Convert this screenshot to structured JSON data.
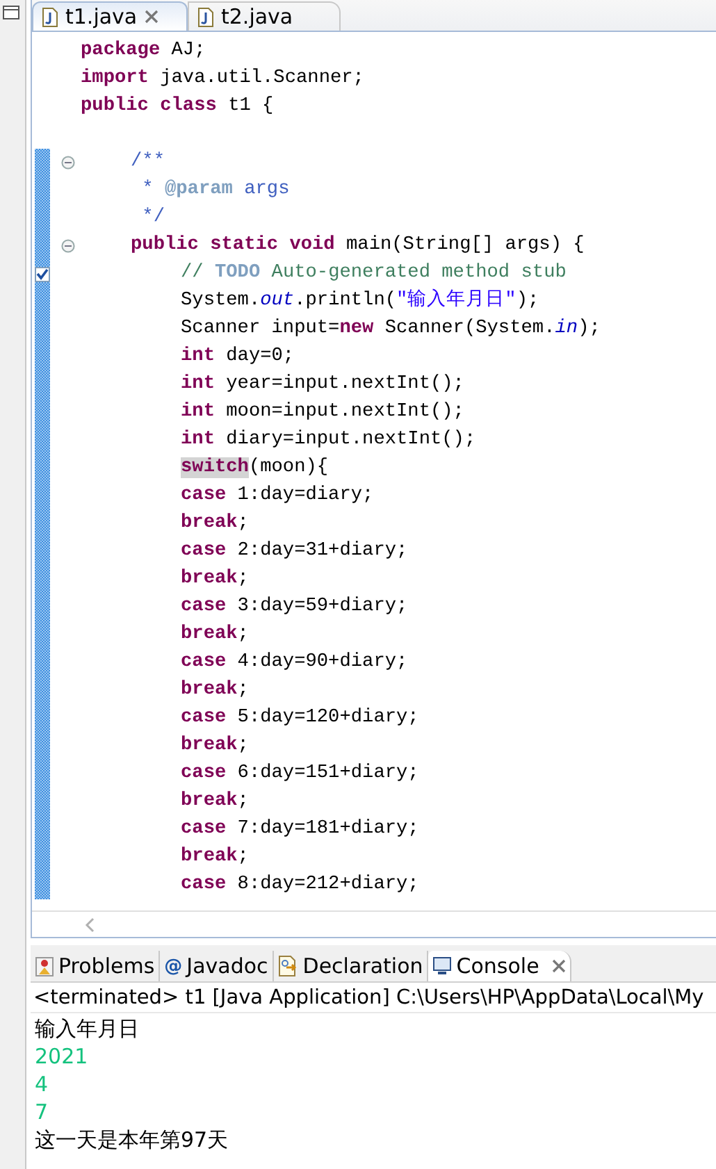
{
  "editor_tabs": [
    {
      "label": "t1.java",
      "selected": true
    },
    {
      "label": "t2.java",
      "selected": false
    }
  ],
  "code": [
    {
      "kind": "code",
      "in_scope": false,
      "tokens": [
        {
          "kind": "kw",
          "text": "package"
        },
        {
          "kind": "plain",
          "text": " AJ;"
        }
      ]
    },
    {
      "kind": "code",
      "in_scope": false,
      "tokens": [
        {
          "kind": "kw",
          "text": "import"
        },
        {
          "kind": "plain",
          "text": " java.util.Scanner;"
        }
      ]
    },
    {
      "kind": "code",
      "in_scope": false,
      "tokens": [
        {
          "kind": "kw",
          "text": "public class"
        },
        {
          "kind": "plain",
          "text": " t1 {"
        }
      ],
      "children": [
        {
          "kind": "blank",
          "in_scope": false
        },
        {
          "kind": "code",
          "in_scope": true,
          "foldable": true,
          "tokens": [
            {
              "kind": "doc",
              "text": "/**"
            }
          ]
        },
        {
          "kind": "code",
          "in_scope": true,
          "tokens": [
            {
              "kind": "doc",
              "text": " * "
            },
            {
              "kind": "doctag",
              "text": "@param"
            },
            {
              "kind": "doc",
              "text": " args"
            }
          ]
        },
        {
          "kind": "code",
          "in_scope": true,
          "tokens": [
            {
              "kind": "doc",
              "text": " */"
            }
          ]
        },
        {
          "kind": "code",
          "in_scope": true,
          "foldable": true,
          "tokens": [
            {
              "kind": "kw",
              "text": "public static void"
            },
            {
              "kind": "plain",
              "text": " main(String[] args) {"
            }
          ],
          "children": [
            {
              "kind": "code",
              "in_scope": true,
              "task": true,
              "tokens": [
                {
                  "kind": "comment",
                  "text": "// "
                },
                {
                  "kind": "todo",
                  "text": "TODO"
                },
                {
                  "kind": "comment",
                  "text": " Auto-generated method stub"
                }
              ]
            },
            {
              "kind": "code",
              "in_scope": true,
              "tokens": [
                {
                  "kind": "plain",
                  "text": "System."
                },
                {
                  "kind": "field",
                  "text": "out"
                },
                {
                  "kind": "plain",
                  "text": ".println("
                },
                {
                  "kind": "string",
                  "text": "\"输入年月日\""
                },
                {
                  "kind": "plain",
                  "text": ");"
                }
              ]
            },
            {
              "kind": "code",
              "in_scope": true,
              "tokens": [
                {
                  "kind": "plain",
                  "text": "Scanner input="
                },
                {
                  "kind": "kw",
                  "text": "new"
                },
                {
                  "kind": "plain",
                  "text": " Scanner(System."
                },
                {
                  "kind": "field",
                  "text": "in"
                },
                {
                  "kind": "plain",
                  "text": ");"
                }
              ]
            },
            {
              "kind": "code",
              "in_scope": true,
              "tokens": [
                {
                  "kind": "kw",
                  "text": "int"
                },
                {
                  "kind": "plain",
                  "text": " day=0;"
                }
              ]
            },
            {
              "kind": "code",
              "in_scope": true,
              "tokens": [
                {
                  "kind": "kw",
                  "text": "int"
                },
                {
                  "kind": "plain",
                  "text": " year=input.nextInt();"
                }
              ]
            },
            {
              "kind": "code",
              "in_scope": true,
              "tokens": [
                {
                  "kind": "kw",
                  "text": "int"
                },
                {
                  "kind": "plain",
                  "text": " moon=input.nextInt();"
                }
              ]
            },
            {
              "kind": "code",
              "in_scope": true,
              "tokens": [
                {
                  "kind": "kw",
                  "text": "int"
                },
                {
                  "kind": "plain",
                  "text": " diary=input.nextInt();"
                }
              ]
            },
            {
              "kind": "code",
              "in_scope": true,
              "tokens": [
                {
                  "kind": "match",
                  "text": "switch"
                },
                {
                  "kind": "plain",
                  "text": "(moon){"
                }
              ]
            },
            {
              "kind": "code",
              "in_scope": true,
              "tokens": [
                {
                  "kind": "kw",
                  "text": "case"
                },
                {
                  "kind": "plain",
                  "text": " 1:day=diary;"
                }
              ]
            },
            {
              "kind": "code",
              "in_scope": true,
              "tokens": [
                {
                  "kind": "kw",
                  "text": "break"
                },
                {
                  "kind": "plain",
                  "text": ";"
                }
              ]
            },
            {
              "kind": "code",
              "in_scope": true,
              "tokens": [
                {
                  "kind": "kw",
                  "text": "case"
                },
                {
                  "kind": "plain",
                  "text": " 2:day=31+diary;"
                }
              ]
            },
            {
              "kind": "code",
              "in_scope": true,
              "tokens": [
                {
                  "kind": "kw",
                  "text": "break"
                },
                {
                  "kind": "plain",
                  "text": ";"
                }
              ]
            },
            {
              "kind": "code",
              "in_scope": true,
              "tokens": [
                {
                  "kind": "kw",
                  "text": "case"
                },
                {
                  "kind": "plain",
                  "text": " 3:day=59+diary;"
                }
              ]
            },
            {
              "kind": "code",
              "in_scope": true,
              "tokens": [
                {
                  "kind": "kw",
                  "text": "break"
                },
                {
                  "kind": "plain",
                  "text": ";"
                }
              ]
            },
            {
              "kind": "code",
              "in_scope": true,
              "tokens": [
                {
                  "kind": "kw",
                  "text": "case"
                },
                {
                  "kind": "plain",
                  "text": " 4:day=90+diary;"
                }
              ]
            },
            {
              "kind": "code",
              "in_scope": true,
              "tokens": [
                {
                  "kind": "kw",
                  "text": "break"
                },
                {
                  "kind": "plain",
                  "text": ";"
                }
              ]
            },
            {
              "kind": "code",
              "in_scope": true,
              "tokens": [
                {
                  "kind": "kw",
                  "text": "case"
                },
                {
                  "kind": "plain",
                  "text": " 5:day=120+diary;"
                }
              ]
            },
            {
              "kind": "code",
              "in_scope": true,
              "tokens": [
                {
                  "kind": "kw",
                  "text": "break"
                },
                {
                  "kind": "plain",
                  "text": ";"
                }
              ]
            },
            {
              "kind": "code",
              "in_scope": true,
              "tokens": [
                {
                  "kind": "kw",
                  "text": "case"
                },
                {
                  "kind": "plain",
                  "text": " 6:day=151+diary;"
                }
              ]
            },
            {
              "kind": "code",
              "in_scope": true,
              "tokens": [
                {
                  "kind": "kw",
                  "text": "break"
                },
                {
                  "kind": "plain",
                  "text": ";"
                }
              ]
            },
            {
              "kind": "code",
              "in_scope": true,
              "tokens": [
                {
                  "kind": "kw",
                  "text": "case"
                },
                {
                  "kind": "plain",
                  "text": " 7:day=181+diary;"
                }
              ]
            },
            {
              "kind": "code",
              "in_scope": true,
              "tokens": [
                {
                  "kind": "kw",
                  "text": "break"
                },
                {
                  "kind": "plain",
                  "text": ";"
                }
              ]
            },
            {
              "kind": "code",
              "in_scope": true,
              "tokens": [
                {
                  "kind": "kw",
                  "text": "case"
                },
                {
                  "kind": "plain",
                  "text": " 8:day=212+diary;"
                }
              ]
            }
          ]
        }
      ]
    }
  ],
  "panel_tabs": [
    {
      "label": "Problems",
      "selected": false
    },
    {
      "label": "Javadoc",
      "glyph": "@",
      "selected": false
    },
    {
      "label": "Declaration",
      "selected": false
    },
    {
      "label": "Console",
      "selected": true
    }
  ],
  "console": {
    "header": "<terminated> t1 [Java Application] C:\\Users\\HP\\AppData\\Local\\My",
    "lines": [
      {
        "kind": "output",
        "text": "输入年月日"
      },
      {
        "kind": "input",
        "text": "2021"
      },
      {
        "kind": "input",
        "text": "4"
      },
      {
        "kind": "input",
        "text": "7"
      },
      {
        "kind": "output",
        "text": "这一天是本年第97天"
      }
    ]
  }
}
